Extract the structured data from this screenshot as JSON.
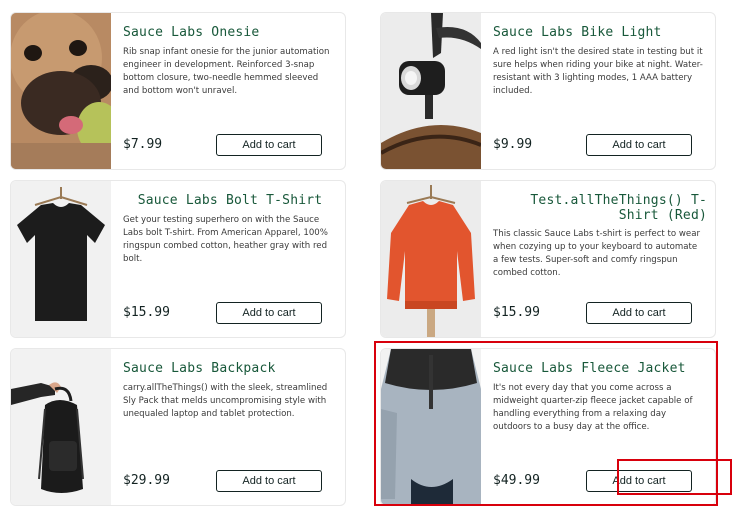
{
  "products": [
    {
      "title": "Sauce Labs Onesie",
      "description": "Rib snap infant onesie for the junior automation engineer in development. Reinforced 3-snap bottom closure, two-needle hemmed sleeved and bottom won't unravel.",
      "price": "$7.99",
      "button": "Add to cart",
      "image": "dog-with-ball-photo"
    },
    {
      "title": "Sauce Labs Bike Light",
      "description": "A red light isn't the desired state in testing but it sure helps when riding your bike at night. Water-resistant with 3 lighting modes, 1 AAA battery included.",
      "price": "$9.99",
      "button": "Add to cart",
      "image": "bike-light-photo"
    },
    {
      "title": "Sauce Labs Bolt T-Shirt",
      "description": "Get your testing superhero on with the Sauce Labs bolt T-shirt. From American Apparel, 100% ringspun combed cotton, heather gray with red bolt.",
      "price": "$15.99",
      "button": "Add to cart",
      "image": "black-tshirt-photo"
    },
    {
      "title": "Test.allTheThings() T-\nShirt (Red)",
      "description": "This classic Sauce Labs t-shirt is perfect to wear when cozying up to your keyboard to automate a few tests. Super-soft and comfy ringspun combed cotton.",
      "price": "$15.99",
      "button": "Add to cart",
      "image": "red-sweatshirt-photo"
    },
    {
      "title": "Sauce Labs Backpack",
      "description": "carry.allTheThings() with the sleek, streamlined Sly Pack that melds uncompromising style with unequaled laptop and tablet protection.",
      "price": "$29.99",
      "button": "Add to cart",
      "image": "backpack-photo"
    },
    {
      "title": "Sauce Labs Fleece Jacket",
      "description": "It's not every day that you come across a midweight quarter-zip fleece jacket capable of handling everything from a relaxing day outdoors to a busy day at the office.",
      "price": "$49.99",
      "button": "Add to cart",
      "image": "fleece-jacket-photo"
    }
  ],
  "colors": {
    "title": "#18583a",
    "text": "#3a3a3a",
    "dark": "#132322",
    "highlight": "#d8000c"
  }
}
